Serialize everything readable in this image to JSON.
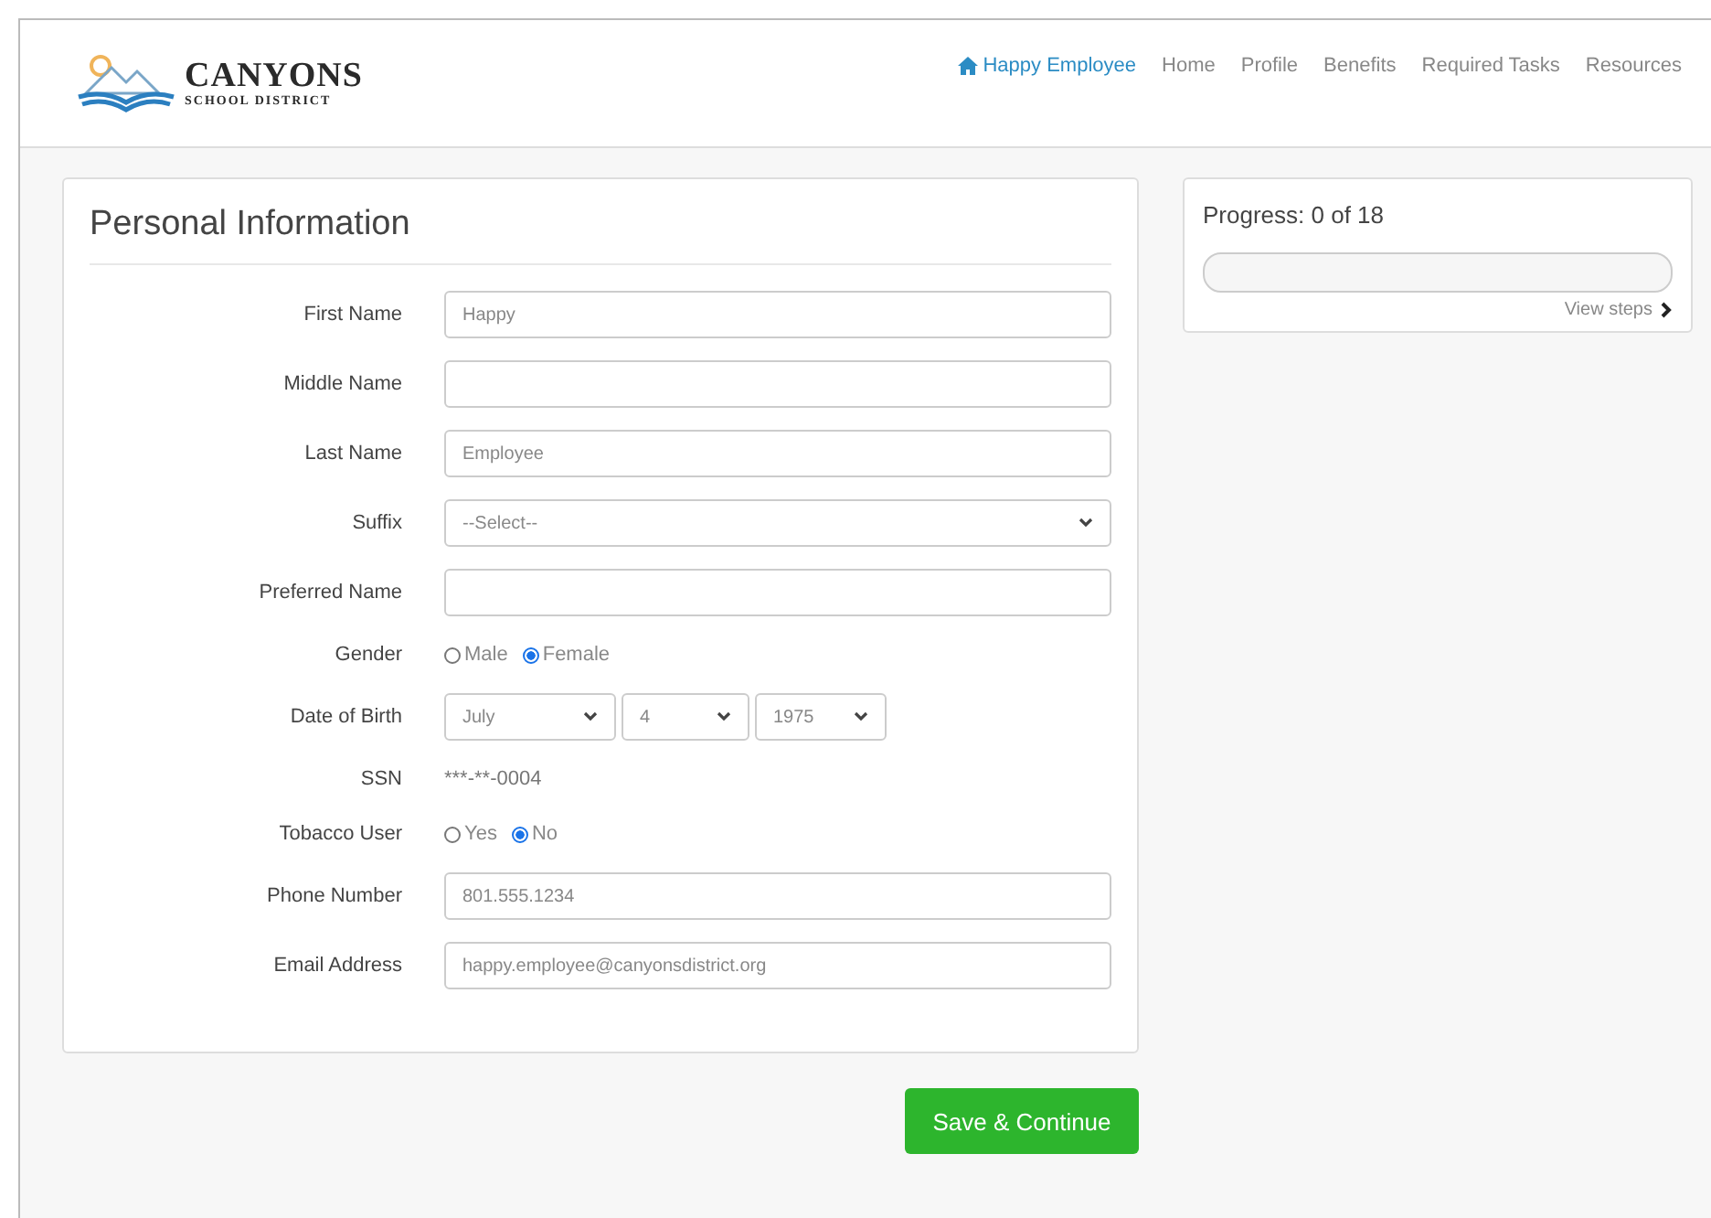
{
  "logo": {
    "title": "CANYONS",
    "subtitle": "SCHOOL DISTRICT"
  },
  "nav": [
    {
      "label": "Happy Employee",
      "kind": "user"
    },
    {
      "label": "Home",
      "kind": "link"
    },
    {
      "label": "Profile",
      "kind": "link"
    },
    {
      "label": "Benefits",
      "kind": "link"
    },
    {
      "label": "Required Tasks",
      "kind": "link"
    },
    {
      "label": "Resources",
      "kind": "link"
    }
  ],
  "form": {
    "title": "Personal Information",
    "fields": [
      {
        "label": "First Name",
        "kind": "text",
        "value": "Happy"
      },
      {
        "label": "Middle Name",
        "kind": "text"
      },
      {
        "label": "Last Name",
        "kind": "text",
        "value": "Employee"
      },
      {
        "label": "Suffix",
        "kind": "select",
        "value": "--Select--"
      },
      {
        "label": "Preferred Name",
        "kind": "text"
      },
      {
        "label": "Gender",
        "kind": "radio",
        "options": [
          {
            "label": "Male",
            "selected": false
          },
          {
            "label": "Female",
            "selected": true
          }
        ]
      },
      {
        "label": "Date of Birth",
        "kind": "date",
        "parts": [
          "July",
          "4",
          "1975"
        ]
      },
      {
        "label": "SSN",
        "kind": "static",
        "value": "***-**-0004"
      },
      {
        "label": "Tobacco User",
        "kind": "radio",
        "options": [
          {
            "label": "Yes",
            "selected": false
          },
          {
            "label": "No",
            "selected": true
          }
        ]
      },
      {
        "label": "Phone Number",
        "kind": "text",
        "value": "801.555.1234"
      },
      {
        "label": "Email Address",
        "kind": "text",
        "value": "happy.employee@canyonsdistrict.org"
      }
    ],
    "submit": "Save & Continue"
  },
  "progress": {
    "title": "Progress: 0 of 18",
    "link": "View steps"
  }
}
